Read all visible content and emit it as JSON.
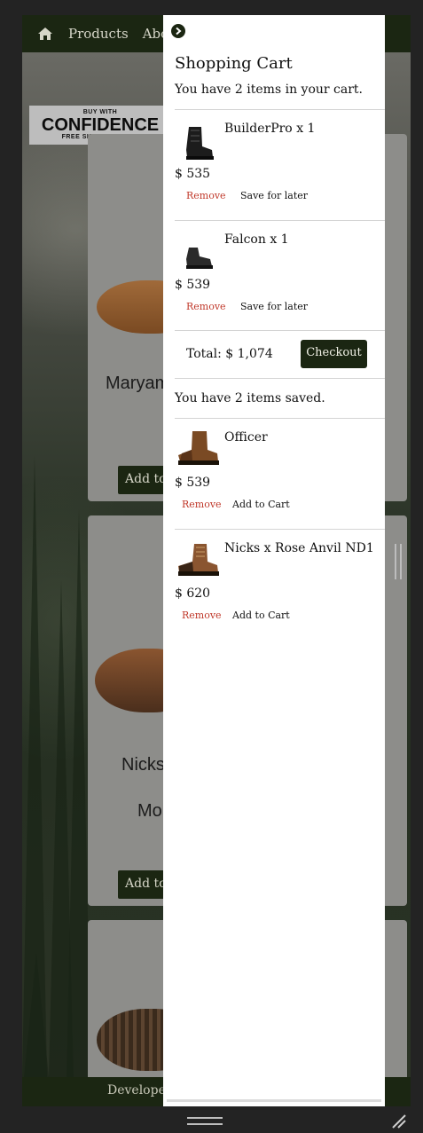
{
  "nav": {
    "links": [
      "Products",
      "About"
    ]
  },
  "banner": {
    "line1": "BUY WITH",
    "line2": "CONFIDENCE",
    "line3": "FREE SIZE EXCHANGE"
  },
  "products": [
    {
      "name": "Maryam",
      "button": "Add to Cart"
    },
    {
      "name": "Nicks",
      "subname": "Mo",
      "button": "Add to Cart"
    }
  ],
  "footer": {
    "text": "Developed"
  },
  "cart": {
    "title": "Shopping Cart",
    "summary": "You have 2 items in your cart.",
    "items": [
      {
        "name": "BuilderPro x 1",
        "price": "$ 535",
        "remove": "Remove",
        "action": "Save for later"
      },
      {
        "name": "Falcon x 1",
        "price": "$ 539",
        "remove": "Remove",
        "action": "Save for later"
      }
    ],
    "total": "Total: $ 1,074",
    "checkout": "Checkout",
    "saved_summary": "You have 2 items saved.",
    "saved": [
      {
        "name": "Officer",
        "price": "$ 539",
        "remove": "Remove",
        "action": "Add to Cart"
      },
      {
        "name": "Nicks x Rose Anvil ND1",
        "price": "$ 620",
        "remove": "Remove",
        "action": "Add to Cart"
      }
    ]
  },
  "colors": {
    "brand_dark_green": "#1b2612",
    "remove_red": "#c0392b",
    "panel_bg": "#ffffff"
  }
}
